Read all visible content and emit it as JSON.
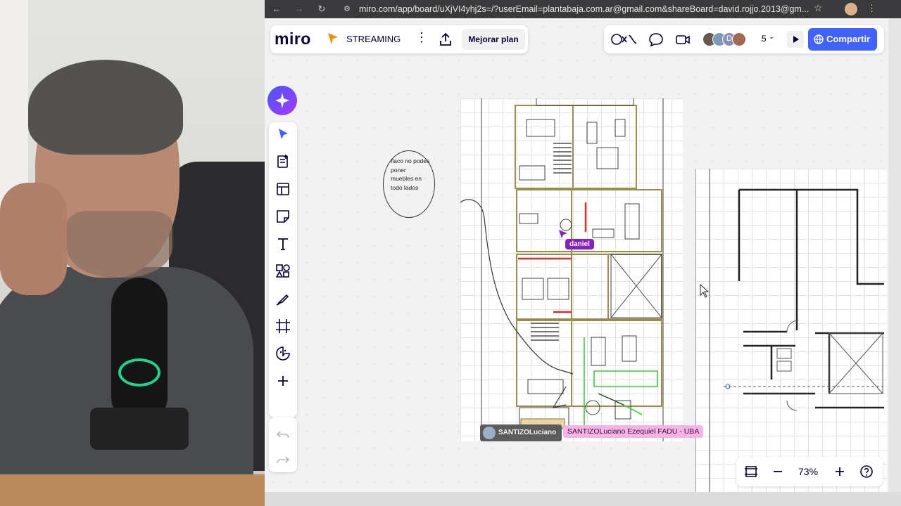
{
  "browser": {
    "url": "miro.com/app/board/uXjVI4yhj2s=/?userEmail=plantabaja.com.ar@gmail.com&shareBoard=david.rojjo.2013@gm..."
  },
  "header": {
    "logo": "miro",
    "board_name": "STREAMING",
    "upgrade_label": "Mejorar plan",
    "share_label": "Compartir",
    "collaborator_count": "5",
    "avatar_initial": "D"
  },
  "canvas": {
    "sticky_note_text": "flaco no podes poner muebles en todo lados",
    "cursor_label_daniel": "daniel",
    "user_tag_short": "SANTIZOLuciano",
    "user_tag_full": "SANTIZOLuciano Ezequiel FADU - UBA"
  },
  "zoom": {
    "value": "73%"
  },
  "colors": {
    "accent": "#4262ff",
    "ai_gradient_start": "#4c54ff",
    "ai_gradient_end": "#a33bff",
    "cursor_daniel": "#8a1fbf",
    "cursor_luciano": "#f6b3e9",
    "board_name_icon": "#ff8a00"
  },
  "icons": {
    "toolbar": [
      "select-icon",
      "template-icon",
      "table-icon",
      "sticky-note-icon",
      "text-icon",
      "shapes-icon",
      "pen-icon",
      "frame-icon",
      "stickers-icon",
      "add-icon"
    ],
    "undo": [
      "undo-icon",
      "redo-icon"
    ]
  }
}
